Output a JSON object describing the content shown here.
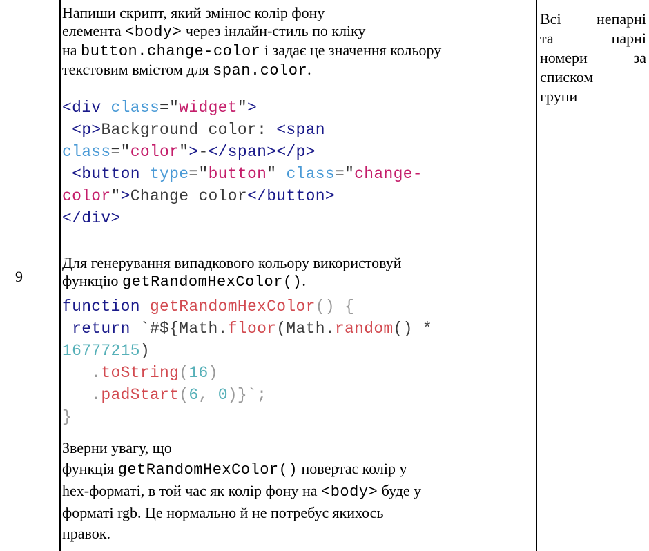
{
  "row_number": "9",
  "task": {
    "para1": {
      "l1": "Напиши скрипт, який змінює колір фону",
      "l2_a": "елемента ",
      "l2_code": "<body>",
      "l2_b": " через інлайн-стиль по кліку",
      "l3_a": "на ",
      "l3_code": "button.change-color",
      "l3_b": " і задає це значення кольору",
      "l4_a": "текстовим вмістом для ",
      "l4_code": "span.color",
      "l4_b": "."
    },
    "html_code": {
      "lt": "<",
      "gt": ">",
      "close_lt": "</",
      "eq": "=",
      "q": "\"",
      "div": "div",
      "p": "p",
      "span": "span",
      "button": "button",
      "class_attr": "class",
      "type_attr": "type",
      "widget": "widget",
      "color": "color",
      "button_val": "button",
      "change_color_1": "change-",
      "change_color_2": "color",
      "bg_text": "Background color: ",
      "dash": "-",
      "btn_text": "Change color"
    },
    "para2": {
      "l1": "Для генерування випадкового кольору використовуй",
      "l2_a": "функцію ",
      "l2_code": "getRandomHexColor()",
      "l2_b": "."
    },
    "js_code": {
      "function_kw": "function",
      "fn_name": "getRandomHexColor",
      "parens_brace": "() {",
      "return_kw": "return",
      "template_open": "`#${Math.",
      "floor": "floor",
      "open_paren_math": "(Math.",
      "random": "random",
      "random_tail": "() *",
      "big_number": "16777215",
      "close_paren": ")",
      "dot": ".",
      "toString": "toString",
      "sixteen": "16",
      "padStart": "padStart",
      "six": "6",
      "zero": "0",
      "tail": ")}`;",
      "close_brace": "}",
      "comma": ", ",
      "open_paren": "("
    },
    "para3": {
      "l1": "Зверни увагу, що",
      "l2_a": "функція ",
      "l2_code": "getRandomHexColor()",
      "l2_b": " повертає колір у",
      "l3_a": "hex-форматі, в той час як колір фону на ",
      "l3_code": "<body>",
      "l3_b": " буде у",
      "l4": "форматі rgb. Це нормально й не потребує якихось",
      "l5": "правок."
    }
  },
  "side_note": {
    "r1_a": "Всі",
    "r1_b": "непарні",
    "r2_a": "та",
    "r2_b": "парні",
    "r3_a": "номери",
    "r3_b": "за",
    "r4": "списком",
    "r5": "групи"
  }
}
